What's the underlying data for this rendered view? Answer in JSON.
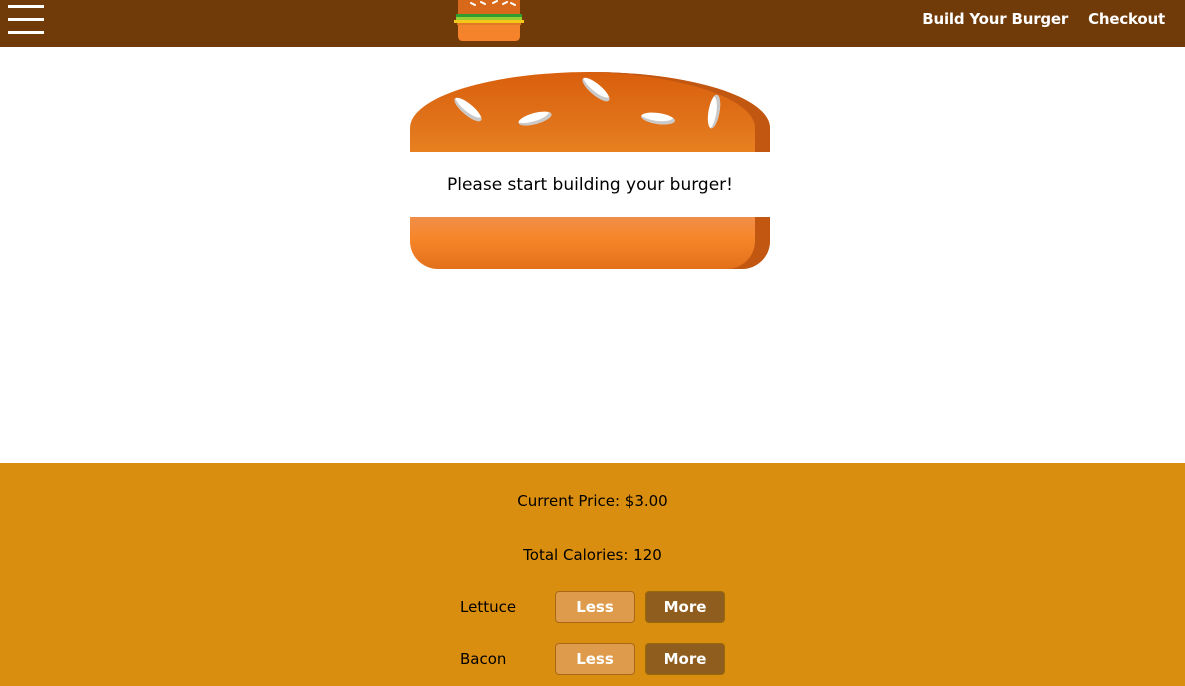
{
  "header": {
    "menu_icon": "hamburger-menu-icon",
    "logo_icon": "burger-logo-icon",
    "nav": [
      {
        "label": "Build Your Burger"
      },
      {
        "label": "Checkout"
      }
    ]
  },
  "burger": {
    "message": "Please start building your burger!"
  },
  "build_controls": {
    "price_text": "Current Price: $3.00",
    "calories_text": "Total Calories: 120",
    "ingredients": [
      {
        "label": "Lettuce",
        "less_label": "Less",
        "more_label": "More"
      },
      {
        "label": "Bacon",
        "less_label": "Less",
        "more_label": "More"
      }
    ]
  },
  "colors": {
    "toolbar": "#703B09",
    "controls_bg": "#DA8E10",
    "less_button": "#DE9B4B",
    "more_button": "#8F5E1E"
  }
}
